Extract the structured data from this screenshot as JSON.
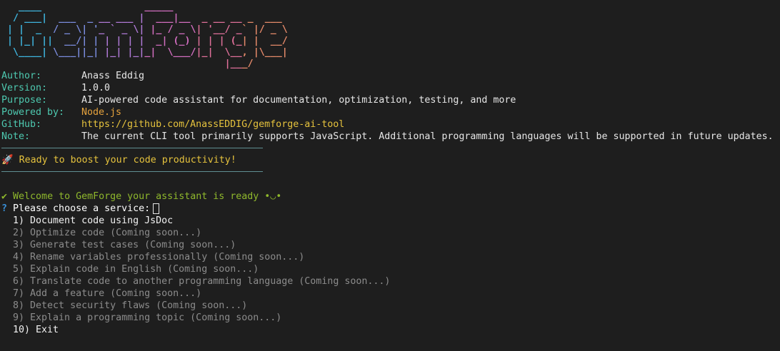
{
  "banner": {
    "lines": [
      "   ____                  _____",
      "  / ___|  ___  _ __ ___ |  ___|__  _ __ __ _  ___",
      " | |  _  / _ \\| '_ ` _ \\| |_ / _ \\| '__/ _` |/ _ \\",
      " | |_| ||  __/| | | | | |  _| (_) | | | (_| |  __/",
      "  \\____| \\___||_| |_| |_|_|  \\___/|_|  \\__, |\\___|",
      "                                       |___/"
    ],
    "gradient": [
      "#3fb6e0",
      "#7b8cde",
      "#b07ad6",
      "#d26ec0",
      "#e0709a",
      "#e58a6a"
    ]
  },
  "info": [
    {
      "label": "Author:",
      "value": "Anass Eddig",
      "color": "default"
    },
    {
      "label": "Version:",
      "value": "1.0.0",
      "color": "default"
    },
    {
      "label": "Purpose:",
      "value": "AI-powered code assistant for documentation, optimization, testing, and more",
      "color": "default"
    },
    {
      "label": "Powered by:",
      "value": "Node.js",
      "color": "orange"
    },
    {
      "label": "GitHub:",
      "value": "https://github.com/AnassEDDIG/gemforge-ai-tool",
      "color": "yellow"
    },
    {
      "label": "Note:",
      "value": "The current CLI tool primarily supports JavaScript. Additional programming languages will be supported in future updates.",
      "color": "default"
    }
  ],
  "ready": {
    "icon": "rocket-icon",
    "glyph": "🚀",
    "text": "Ready to boost your code productivity!"
  },
  "welcome": {
    "glyph": "✔",
    "text": "Welcome to GemForge your assistant is ready •◡•"
  },
  "prompt": {
    "glyph": "?",
    "text": "Please choose a service:"
  },
  "menu": [
    {
      "text": "  1) Document code using JsDoc",
      "active": true
    },
    {
      "text": "  2) Optimize code (Coming soon...)",
      "active": false
    },
    {
      "text": "  3) Generate test cases (Coming soon...)",
      "active": false
    },
    {
      "text": "  4) Rename variables professionally (Coming soon...)",
      "active": false
    },
    {
      "text": "  5) Explain code in English (Coming soon...)",
      "active": false
    },
    {
      "text": "  6) Translate code to another programming language (Coming soon...)",
      "active": false
    },
    {
      "text": "  7) Add a feature (Coming soon...)",
      "active": false
    },
    {
      "text": "  8) Detect security flaws (Coming soon...)",
      "active": false
    },
    {
      "text": "  9) Explain a programming topic (Coming soon...)",
      "active": false
    },
    {
      "text": "  10) Exit",
      "active": true
    }
  ],
  "colors": {
    "background": "#1e1e1e",
    "label": "#4ec9b0",
    "orange": "#e5a23d",
    "yellow": "#e5c23d",
    "success": "#8fb82c",
    "question": "#3a8fd6",
    "dim": "#8c8c8c",
    "separator": "#5f8f92"
  }
}
